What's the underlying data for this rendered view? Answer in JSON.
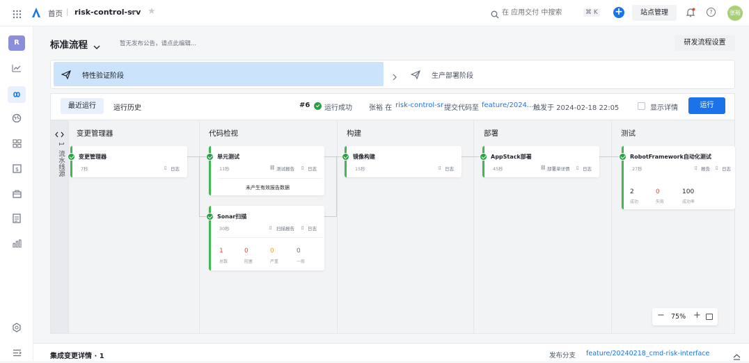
{
  "topbar": {
    "home": "首页",
    "separator": "|",
    "project": "risk-control-srv",
    "search_placeholder": "在 应用交付 中搜索",
    "shortcut": "⌘ K",
    "site_admin": "站点管理",
    "avatar": "张裕"
  },
  "sidebar": {
    "project_initial": "R"
  },
  "header": {
    "title": "标准流程",
    "notice": "暂无发布公告，请点此编辑...",
    "settings_button": "研发流程设置"
  },
  "stages": [
    {
      "label": "特性验证阶段"
    },
    {
      "label": "生产部署阶段"
    }
  ],
  "toolbar": {
    "tab_recent": "最近运行",
    "tab_history": "运行历史",
    "run_no": "#6",
    "status": "运行成功",
    "author": "张裕 在",
    "repo": "risk-control-sr",
    "commit_text": "提交代码至",
    "branch_short": "feature/2024...",
    "trigger": "触发于 2024-02-18 22:05",
    "show_details": "显示详情",
    "run_button": "运行"
  },
  "pipeline": {
    "source_label": "流水线源",
    "source_count": "1",
    "columns": [
      "变更管理器",
      "代码检视",
      "构建",
      "部署",
      "测试"
    ],
    "jobs": {
      "change": {
        "name": "变更管理器",
        "time": "7秒",
        "log": "日志"
      },
      "unit": {
        "name": "单元测试",
        "time": "11秒",
        "report": "测试报告",
        "log": "日志",
        "empty": "未产生有效报告数据"
      },
      "sonar": {
        "name": "Sonar扫描",
        "time": "30秒",
        "report": "扫描报告",
        "log": "日志",
        "stats": [
          {
            "value": "1",
            "label": "总数",
            "color": "#e5483a"
          },
          {
            "value": "0",
            "label": "阻塞",
            "color": "#e5483a"
          },
          {
            "value": "0",
            "label": "严重",
            "color": "#f59a23"
          },
          {
            "value": "0",
            "label": "一般",
            "color": "#6b7280"
          }
        ]
      },
      "build": {
        "name": "镜像构建",
        "time": "15秒",
        "log": "日志"
      },
      "deploy": {
        "name": "AppStack部署",
        "time": "45秒",
        "detail": "部署单详情",
        "log": "日志"
      },
      "test": {
        "name": "RobotFramework自动化测试",
        "time": "27秒",
        "report": "报告",
        "log": "日志",
        "stats": [
          {
            "value": "2",
            "label": "成功",
            "color": "#1f2329"
          },
          {
            "value": "0",
            "label": "失败",
            "color": "#e5483a"
          },
          {
            "value": "100",
            "label": "成功率",
            "color": "#1f2329"
          }
        ]
      }
    },
    "zoom": "75%"
  },
  "footer": {
    "title": "集成变更详情 · 1",
    "branch_label": "发布分支",
    "branch": "feature/20240218_cmd-risk-interface"
  }
}
